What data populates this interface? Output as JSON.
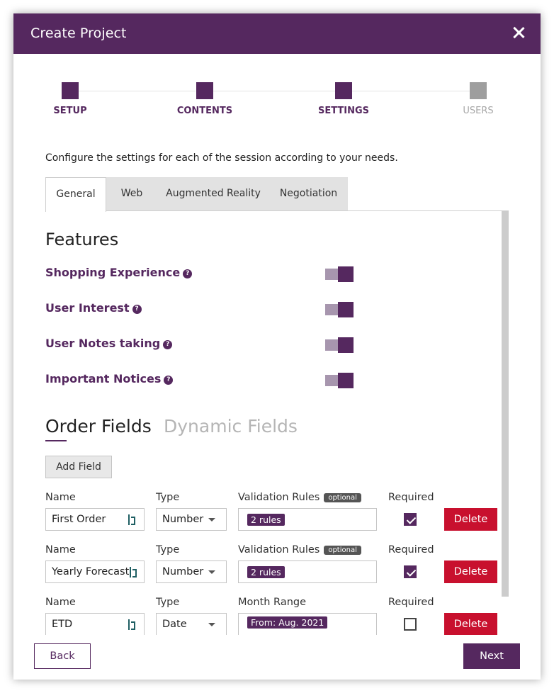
{
  "modal": {
    "title": "Create Project",
    "close_icon": "close-icon"
  },
  "stepper": {
    "steps": [
      {
        "label": "SETUP",
        "state": "complete"
      },
      {
        "label": "CONTENTS",
        "state": "complete"
      },
      {
        "label": "SETTINGS",
        "state": "current"
      },
      {
        "label": "USERS",
        "state": "pending"
      }
    ]
  },
  "intro_text": "Configure the settings for each of the session according to your needs.",
  "tabs": [
    {
      "label": "General",
      "active": true
    },
    {
      "label": "Web",
      "active": false
    },
    {
      "label": "Augmented Reality",
      "active": false
    },
    {
      "label": "Negotiation",
      "active": false
    }
  ],
  "features": {
    "title": "Features",
    "items": [
      {
        "label": "Shopping Experience",
        "help": "?",
        "enabled": true
      },
      {
        "label": "User Interest",
        "help": "?",
        "enabled": true
      },
      {
        "label": "User Notes taking",
        "help": "?",
        "enabled": true
      },
      {
        "label": "Important Notices",
        "help": "?",
        "enabled": true
      }
    ]
  },
  "field_tabs": [
    {
      "label": "Order Fields",
      "active": true
    },
    {
      "label": "Dynamic Fields",
      "active": false
    }
  ],
  "add_field_label": "Add Field",
  "fields": [
    {
      "name_label": "Name",
      "name": "First Order",
      "type_label": "Type",
      "type": "Number",
      "rules_label": "Validation Rules",
      "optional": "optional",
      "rules_chip": "2 rules",
      "required_label": "Required",
      "required": true,
      "delete_label": "Delete"
    },
    {
      "name_label": "Name",
      "name": "Yearly Forecast",
      "type_label": "Type",
      "type": "Number",
      "rules_label": "Validation Rules",
      "optional": "optional",
      "rules_chip": "2 rules",
      "required_label": "Required",
      "required": true,
      "delete_label": "Delete"
    },
    {
      "name_label": "Name",
      "name": "ETD",
      "type_label": "Type",
      "type": "Date",
      "rules_label": "Month Range",
      "rules_chip": "From: Aug. 2021",
      "required_label": "Required",
      "required": false,
      "delete_label": "Delete"
    }
  ],
  "footer": {
    "back_label": "Back",
    "next_label": "Next"
  },
  "colors": {
    "brand": "#55285f",
    "danger": "#c8102e",
    "inactive_step": "#9e9e9e"
  }
}
